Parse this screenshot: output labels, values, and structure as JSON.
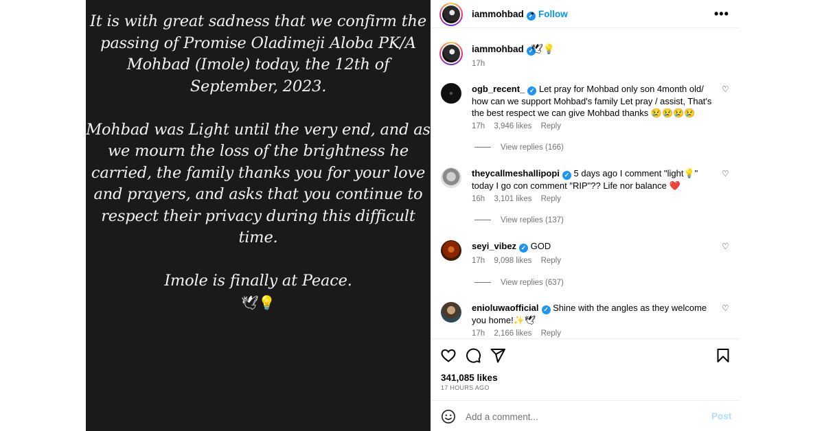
{
  "story": {
    "paragraphs": [
      "It is with great sadness that we confirm the passing of Promise Oladimeji Aloba PK/A Mohbad (Imole) today, the 12th of September, 2023.",
      "Mohbad was Light until the very end, and as we mourn the loss of the brightness he carried, the family thanks you for your love and prayers, and asks that you continue to respect their privacy during this difficult time.",
      "Imole is finally at Peace."
    ],
    "closing_emojis": "🕊💡"
  },
  "header": {
    "username": "iammohbad",
    "separator": "•",
    "follow_label": "Follow",
    "more_label": "•••"
  },
  "caption": {
    "username": "iammohbad",
    "text": "🕊💡",
    "time": "17h"
  },
  "comments": [
    {
      "username": "ogb_recent_",
      "text": "Let pray for Mohbad only son 4month old/ how can we support Mohbad's family Let pray / assist, That's the best respect we can give Mohbad thanks 😢😢😢😢",
      "time": "17h",
      "likes": "3,946 likes",
      "reply": "Reply",
      "view_replies": "View replies (166)"
    },
    {
      "username": "theycallmeshallipopi",
      "text": "5 days ago I comment \"light💡\" today I go con comment \"RIP\"?? Life nor balance ❤️",
      "time": "16h",
      "likes": "3,101 likes",
      "reply": "Reply",
      "view_replies": "View replies (137)"
    },
    {
      "username": "seyi_vibez",
      "text": "GOD",
      "time": "17h",
      "likes": "9,098 likes",
      "reply": "Reply",
      "view_replies": "View replies (637)"
    },
    {
      "username": "enioluwaofficial",
      "text": "Shine with the angles as they welcome you home!✨🕊",
      "time": "17h",
      "likes": "2,166 likes",
      "reply": "Reply"
    }
  ],
  "footer": {
    "likes": "341,085 likes",
    "time_ago": "17 HOURS AGO"
  },
  "add_comment": {
    "placeholder": "Add a comment...",
    "post_label": "Post"
  },
  "colors": {
    "accent": "#0095f6",
    "verified": "#1e95f3",
    "muted": "#737373",
    "post_disabled": "#b3dbff",
    "story_bg": "#1a1a1a"
  }
}
